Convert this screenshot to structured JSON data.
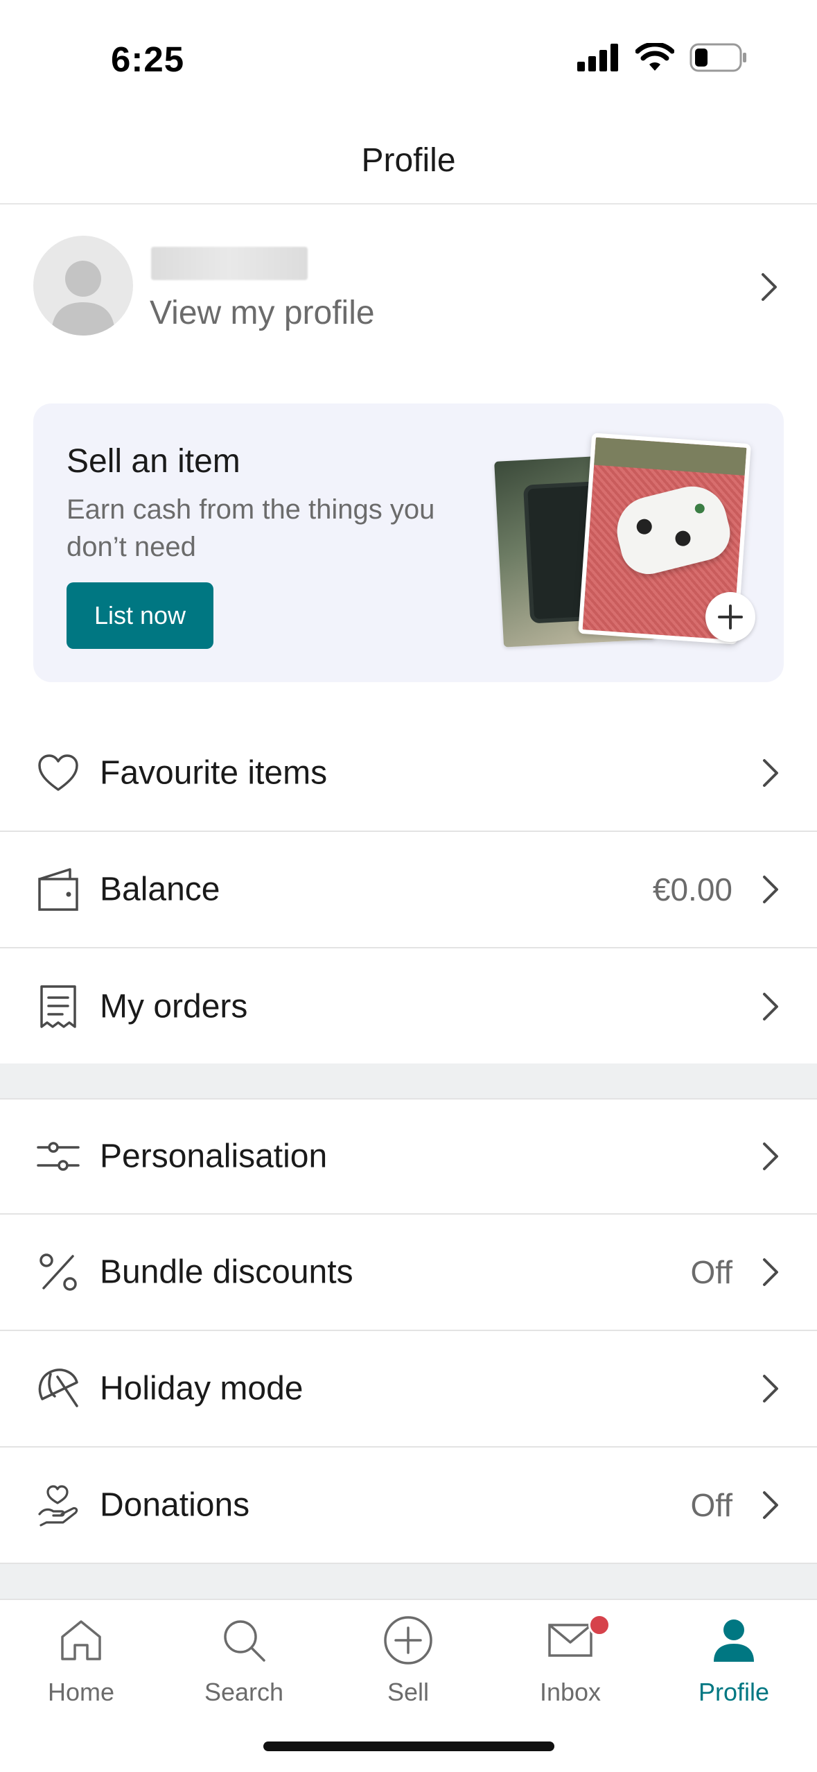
{
  "status_bar": {
    "time": "6:25"
  },
  "header": {
    "title": "Profile"
  },
  "profile": {
    "view_label": "View my profile"
  },
  "sell_card": {
    "title": "Sell an item",
    "subtitle": "Earn cash from the things you don’t need",
    "button_label": "List now"
  },
  "menu": {
    "favourites": {
      "label": "Favourite items",
      "icon": "heart-icon"
    },
    "balance": {
      "label": "Balance",
      "value": "€0.00",
      "icon": "wallet-icon"
    },
    "orders": {
      "label": "My orders",
      "icon": "receipt-icon"
    },
    "personalisation": {
      "label": "Personalisation",
      "icon": "sliders-icon"
    },
    "bundle": {
      "label": "Bundle discounts",
      "value": "Off",
      "icon": "percent-icon"
    },
    "holiday": {
      "label": "Holiday mode",
      "icon": "umbrella-off-icon"
    },
    "donations": {
      "label": "Donations",
      "value": "Off",
      "icon": "heart-hand-icon"
    }
  },
  "tabs": [
    {
      "label": "Home",
      "icon": "home-icon"
    },
    {
      "label": "Search",
      "icon": "search-icon"
    },
    {
      "label": "Sell",
      "icon": "plus-circle-icon"
    },
    {
      "label": "Inbox",
      "icon": "mail-icon"
    },
    {
      "label": "Profile",
      "icon": "person-icon"
    }
  ],
  "colors": {
    "accent": "#007782",
    "badge": "#d6424b",
    "card_bg": "#f2f3fb"
  }
}
